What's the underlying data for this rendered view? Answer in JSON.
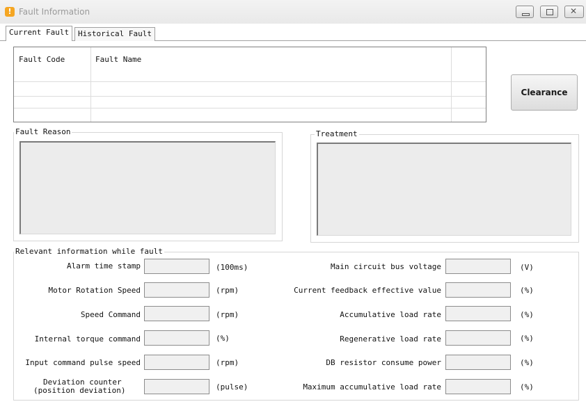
{
  "window": {
    "title": "Fault Information",
    "icon": "warning-icon",
    "buttons": [
      "minimize-icon",
      "maximize-icon",
      "close-icon"
    ]
  },
  "tabs": [
    {
      "label": "Current Fault",
      "active": true
    },
    {
      "label": "Historical Fault",
      "active": false
    }
  ],
  "fault_table": {
    "columns": [
      "Fault Code",
      "Fault Name"
    ],
    "rows": []
  },
  "clearance_button": "Clearance",
  "fault_reason": {
    "label": "Fault Reason",
    "value": ""
  },
  "treatment": {
    "label": "Treatment",
    "value": ""
  },
  "relevant_info": {
    "label": "Relevant information while fault",
    "left": [
      {
        "label": "Alarm time stamp",
        "value": "",
        "unit": "(100ms)"
      },
      {
        "label": "Motor Rotation Speed",
        "value": "",
        "unit": "(rpm)"
      },
      {
        "label": "Speed Command",
        "value": "",
        "unit": "(rpm)"
      },
      {
        "label": "Internal torque command",
        "value": "",
        "unit": "(%)"
      },
      {
        "label": "Input command pulse speed",
        "value": "",
        "unit": "(rpm)"
      },
      {
        "label_line1": "Deviation counter",
        "label_line2": "(position deviation)",
        "value": "",
        "unit": "(pulse)"
      }
    ],
    "right": [
      {
        "label": "Main circuit bus voltage",
        "value": "",
        "unit": "(V)"
      },
      {
        "label": "Current feedback effective value",
        "value": "",
        "unit": "(%)"
      },
      {
        "label": "Accumulative load rate",
        "value": "",
        "unit": "(%)"
      },
      {
        "label": "Regenerative load rate",
        "value": "",
        "unit": "(%)"
      },
      {
        "label": "DB resistor consume power",
        "value": "",
        "unit": "(%)"
      },
      {
        "label": "Maximum accumulative load rate",
        "value": "",
        "unit": "(%)"
      }
    ]
  }
}
